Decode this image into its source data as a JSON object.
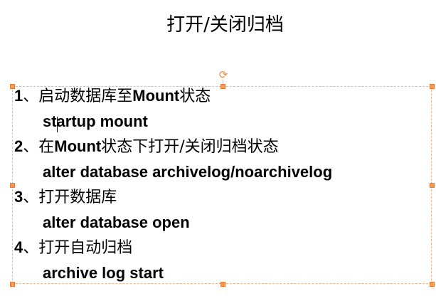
{
  "slide": {
    "title": "打开/关闭归档"
  },
  "steps": [
    {
      "num": "1",
      "sep": "、",
      "text_pre": "启动数据库至",
      "text_bold": "Mount",
      "text_post": "状态",
      "command": "startup mount"
    },
    {
      "num": "2",
      "sep": "、",
      "text_pre": "在",
      "text_bold": "Mount",
      "text_post": "状态下打开/关闭归档状态",
      "command": "alter database archivelog/noarchivelog"
    },
    {
      "num": "3",
      "sep": "、",
      "text_pre": "打开数据库",
      "text_bold": "",
      "text_post": "",
      "command": "alter database open"
    },
    {
      "num": "4",
      "sep": "、",
      "text_pre": "打开自动归档",
      "text_bold": "",
      "text_post": "",
      "command": "archive log start"
    }
  ],
  "icons": {
    "rotate": "rotate-icon"
  },
  "colors": {
    "selection_border": "#f2b48a",
    "handle_fill": "#f29a5e"
  }
}
